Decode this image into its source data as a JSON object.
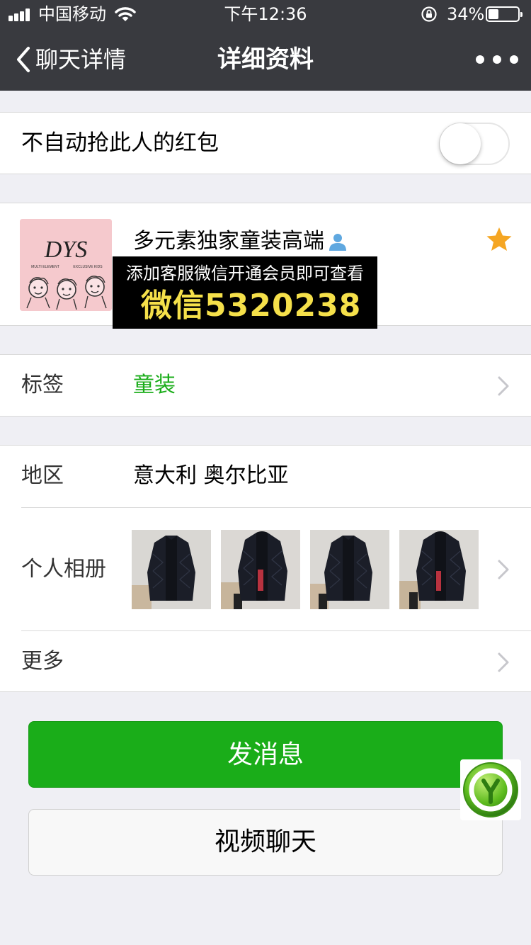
{
  "status_bar": {
    "carrier": "中国移动",
    "time": "下午12:36",
    "battery_percent": "34%",
    "battery_level": 0.34
  },
  "nav": {
    "back_label": "聊天详情",
    "title": "详细资料"
  },
  "red_packet": {
    "label": "不自动抢此人的红包",
    "enabled": false
  },
  "profile": {
    "name": "多元素独家童装高端",
    "starred": true,
    "avatar_logo": "DYS",
    "avatar_caption_left": "MULTI ELEMENT",
    "avatar_caption_right": "EXCLUSIVE KIDS"
  },
  "promo_overlay": {
    "line1": "添加客服微信开通会员即可查看",
    "line2": "微信5320238"
  },
  "tags": {
    "label": "标签",
    "value": "童装"
  },
  "region": {
    "label": "地区",
    "value": "意大利 奥尔比亚"
  },
  "album": {
    "label": "个人相册",
    "photos": [
      {
        "subject": "black quilted jacket"
      },
      {
        "subject": "black quilted jacket"
      },
      {
        "subject": "black quilted jacket"
      },
      {
        "subject": "black quilted jacket"
      }
    ]
  },
  "more": {
    "label": "更多"
  },
  "actions": {
    "send_message": "发消息",
    "video_call": "视频聊天"
  },
  "colors": {
    "nav_bg": "#393A3F",
    "page_bg": "#EFEFF4",
    "wechat_green": "#1AAD19",
    "star": "#F5A623",
    "promo_text": "#F5E04A"
  }
}
